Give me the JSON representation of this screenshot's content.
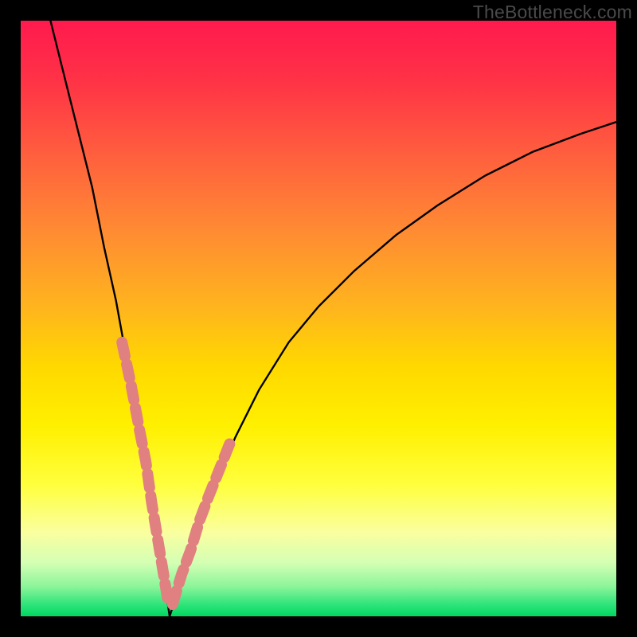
{
  "watermark_text": "TheBottleneck.com",
  "chart_data": {
    "type": "line",
    "title": "",
    "xlabel": "",
    "ylabel": "",
    "xlim": [
      0,
      100
    ],
    "ylim": [
      0,
      100
    ],
    "grid": false,
    "notes": "Two black curves descending into a V-shaped minimum near x≈25 against a vertical hue gradient (red→yellow→green). Pink segments overlay portions of the curves in the lower region. Values estimated visually; no numeric axis labels are shown.",
    "series": [
      {
        "name": "left-curve",
        "x": [
          5,
          8,
          10,
          12,
          14,
          16,
          18,
          20,
          22,
          24,
          25
        ],
        "y": [
          100,
          88,
          80,
          72,
          62,
          53,
          42,
          31,
          19,
          7,
          0
        ]
      },
      {
        "name": "right-curve",
        "x": [
          25,
          27,
          29,
          32,
          36,
          40,
          45,
          50,
          56,
          63,
          70,
          78,
          86,
          94,
          100
        ],
        "y": [
          0,
          6,
          12,
          20,
          30,
          38,
          46,
          52,
          58,
          64,
          69,
          74,
          78,
          81,
          83
        ]
      },
      {
        "name": "left-pink-overlay",
        "x": [
          17,
          18.5,
          20,
          21,
          22,
          23,
          24,
          24.8
        ],
        "y": [
          46,
          39,
          31,
          26,
          19,
          13,
          7,
          2
        ]
      },
      {
        "name": "right-pink-overlay",
        "x": [
          25.5,
          27,
          28.5,
          30,
          31.5,
          33.5,
          35.5
        ],
        "y": [
          2,
          7,
          11,
          16,
          20,
          25,
          30
        ]
      }
    ],
    "background_gradient": {
      "direction": "top-to-bottom",
      "stops": [
        {
          "pct": 0,
          "color": "#ff1a4e"
        },
        {
          "pct": 22,
          "color": "#ff5d3e"
        },
        {
          "pct": 48,
          "color": "#ffb41e"
        },
        {
          "pct": 68,
          "color": "#fff000"
        },
        {
          "pct": 86,
          "color": "#faffa0"
        },
        {
          "pct": 95,
          "color": "#8cf59a"
        },
        {
          "pct": 100,
          "color": "#00d860"
        }
      ]
    }
  }
}
